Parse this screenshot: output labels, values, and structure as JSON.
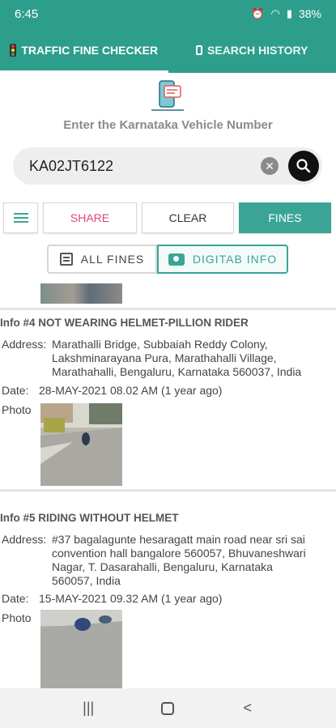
{
  "status": {
    "time": "6:45",
    "battery": "38%",
    "icons": [
      "alarm-icon",
      "wifi-icon",
      "signal-icon"
    ]
  },
  "tabs": [
    {
      "label": "TRAFFIC FINE CHECKER",
      "icon": "traffic-light-icon",
      "active": true
    },
    {
      "label": "SEARCH  HISTORY",
      "icon": "phone-icon",
      "active": false
    }
  ],
  "prompt": "Enter the Karnataka Vehicle Number",
  "search": {
    "value": "KA02JT6122"
  },
  "buttons": {
    "share": "SHARE",
    "clear": "CLEAR",
    "fines": "FINES"
  },
  "segments": {
    "all_fines": "ALL FINES",
    "digitab_info": "DIGITAB INFO"
  },
  "fines": [
    {
      "title": "Info #4 NOT WEARING HELMET-PILLION RIDER",
      "address_label": "Address:",
      "address": "Marathalli Bridge, Subbaiah Reddy Colony, Lakshminarayana Pura, Marathahalli Village, Marathahalli, Bengaluru, Karnataka 560037, India",
      "date_label": "Date:",
      "date": "28-MAY-2021 08.02 AM (1 year ago)",
      "photo_label": "Photo"
    },
    {
      "title": "Info #5 RIDING WITHOUT HELMET",
      "address_label": "Address:",
      "address": "#37 bagalagunte hesaragatt main road near sri sai convention hall bangalore 560057, Bhuvaneshwari Nagar, T. Dasarahalli, Bengaluru, Karnataka 560057, India",
      "date_label": "Date:",
      "date": "15-MAY-2021 09.32 AM (1 year ago)",
      "photo_label": "Photo"
    }
  ],
  "colors": {
    "primary": "#2e9e8c",
    "accent": "#3aa596",
    "share": "#e0467a"
  }
}
